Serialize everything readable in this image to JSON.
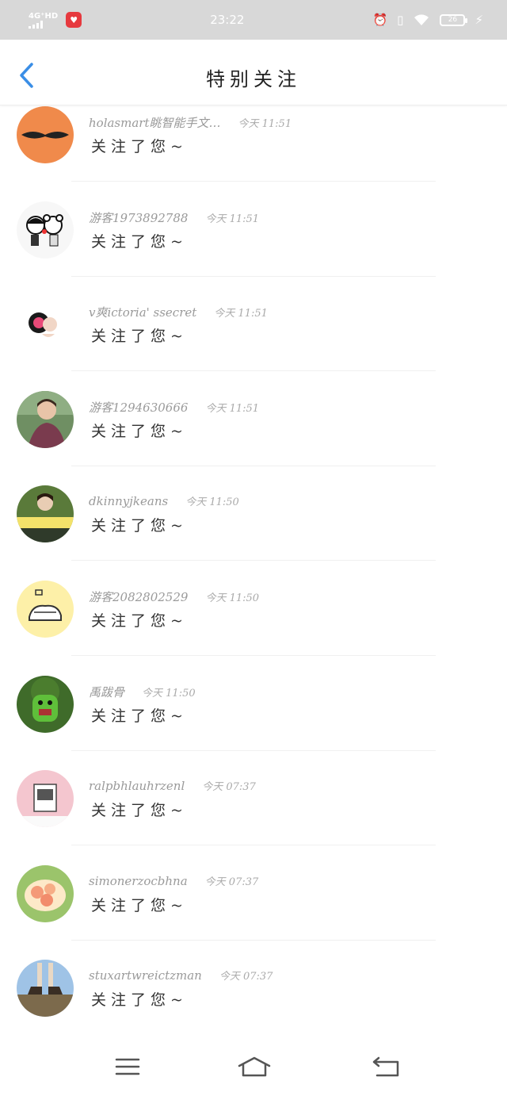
{
  "status_bar": {
    "network": "4G⁺HD",
    "time": "23:22",
    "battery": "26"
  },
  "header": {
    "title": "特别关注"
  },
  "follows": [
    {
      "name": "holasmart眺智能手文…",
      "time": "今天 11:51",
      "message": "关注了您~"
    },
    {
      "name": "游客1973892788",
      "time": "今天 11:51",
      "message": "关注了您~"
    },
    {
      "name": "v爽ictoria' ssecret",
      "time": "今天 11:51",
      "message": "关注了您~"
    },
    {
      "name": "游客1294630666",
      "time": "今天 11:51",
      "message": "关注了您~"
    },
    {
      "name": "dkinnyjkeans",
      "time": "今天 11:50",
      "message": "关注了您~"
    },
    {
      "name": "游客2082802529",
      "time": "今天 11:50",
      "message": "关注了您~"
    },
    {
      "name": "禹跋骨",
      "time": "今天 11:50",
      "message": "关注了您~"
    },
    {
      "name": "ralpbhlauhrzenl",
      "time": "今天 07:37",
      "message": "关注了您~"
    },
    {
      "name": "simonerzocbhna",
      "time": "今天 07:37",
      "message": "关注了您~"
    },
    {
      "name": "stuxartwreictzman",
      "time": "今天 07:37",
      "message": "关注了您~"
    }
  ],
  "colors": {
    "accent": "#3a8ee6",
    "status_bar_bg": "#d8d8d8"
  },
  "icons": {
    "back": "chevron-left-icon",
    "menu": "menu-icon",
    "home": "home-icon",
    "return": "return-icon"
  }
}
